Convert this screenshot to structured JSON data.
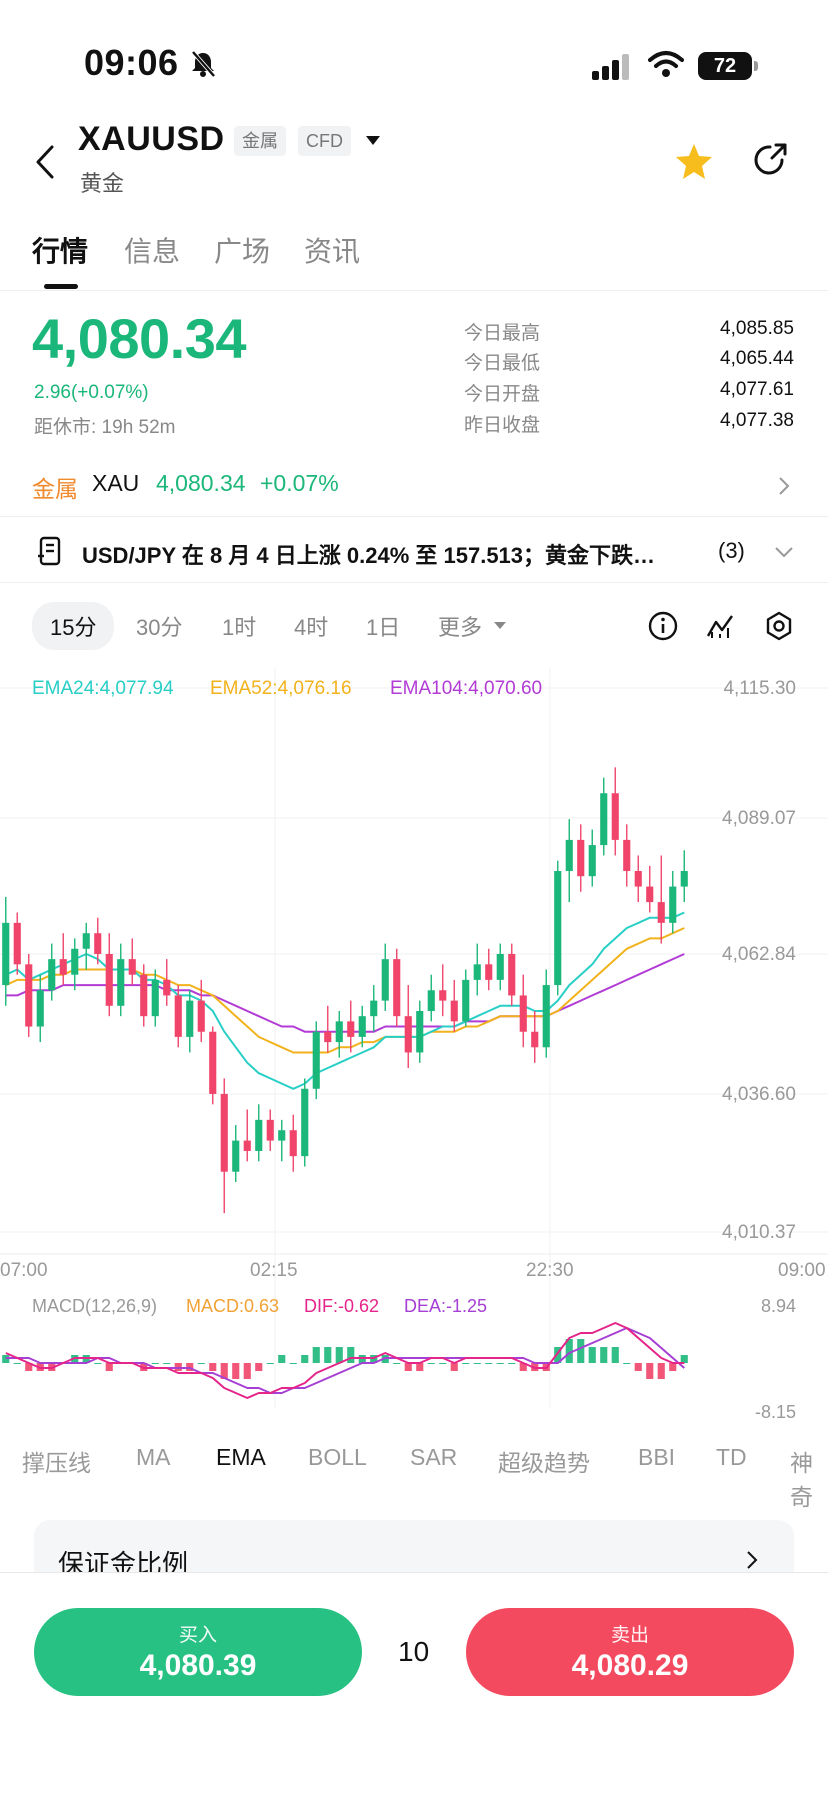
{
  "status_bar": {
    "time": "09:06",
    "battery": "72"
  },
  "header": {
    "symbol": "XAUUSD",
    "tags": [
      "金属",
      "CFD"
    ],
    "name": "黄金"
  },
  "tabs": [
    {
      "label": "行情"
    },
    {
      "label": "信息"
    },
    {
      "label": "广场"
    },
    {
      "label": "资讯"
    }
  ],
  "quote": {
    "price": "4,080.34",
    "change": "2.96(+0.07%)",
    "countdown": "距休市: 19h 52m",
    "stats": [
      {
        "label": "今日最高",
        "value": "4,085.85"
      },
      {
        "label": "今日最低",
        "value": "4,065.44"
      },
      {
        "label": "今日开盘",
        "value": "4,077.61"
      },
      {
        "label": "昨日收盘",
        "value": "4,077.38"
      }
    ]
  },
  "metal_row": {
    "category": "金属",
    "code": "XAU",
    "price": "4,080.34",
    "change": "+0.07%"
  },
  "news": {
    "headline": "USD/JPY 在 8 月 4 日上涨 0.24% 至 157.513；黄金下跌…",
    "count": "(3)"
  },
  "periods": [
    {
      "label": "15分"
    },
    {
      "label": "30分"
    },
    {
      "label": "1时"
    },
    {
      "label": "4时"
    },
    {
      "label": "1日"
    },
    {
      "label": "更多"
    }
  ],
  "colors": {
    "up": "#1bb77a",
    "down": "#f0446a",
    "ema24": "#27cfc6",
    "ema52": "#f2b21c",
    "ema104": "#b23bd6",
    "macd": "#f2a134",
    "dif": "#e5258a",
    "dea": "#a63fd4"
  },
  "chart_data": {
    "type": "candlestick",
    "legend": [
      {
        "name": "EMA24",
        "value": "EMA24:4,077.94"
      },
      {
        "name": "EMA52",
        "value": "EMA52:4,076.16"
      },
      {
        "name": "EMA104",
        "value": "EMA104:4,070.60"
      }
    ],
    "y_ticks": [
      "4,115.30",
      "4,089.07",
      "4,062.84",
      "4,036.60",
      "4,010.37"
    ],
    "ylim": [
      4010.37,
      4115.3
    ],
    "x_ticks": [
      "07:00",
      "02:15",
      "22:30",
      "09:00"
    ],
    "ohlc": [
      [
        4058,
        4075,
        4054,
        4070
      ],
      [
        4070,
        4072,
        4060,
        4062
      ],
      [
        4062,
        4064,
        4048,
        4050
      ],
      [
        4050,
        4060,
        4047,
        4057
      ],
      [
        4057,
        4066,
        4055,
        4063
      ],
      [
        4063,
        4068,
        4058,
        4060
      ],
      [
        4060,
        4067,
        4057,
        4065
      ],
      [
        4065,
        4070,
        4061,
        4068
      ],
      [
        4068,
        4071,
        4062,
        4064
      ],
      [
        4064,
        4068,
        4052,
        4054
      ],
      [
        4054,
        4066,
        4052,
        4063
      ],
      [
        4063,
        4067,
        4058,
        4060
      ],
      [
        4060,
        4062,
        4050,
        4052
      ],
      [
        4052,
        4061,
        4050,
        4059
      ],
      [
        4059,
        4063,
        4054,
        4056
      ],
      [
        4056,
        4058,
        4046,
        4048
      ],
      [
        4048,
        4057,
        4045,
        4055
      ],
      [
        4055,
        4059,
        4047,
        4049
      ],
      [
        4049,
        4050,
        4035,
        4037
      ],
      [
        4037,
        4040,
        4014,
        4022
      ],
      [
        4022,
        4031,
        4020,
        4028
      ],
      [
        4028,
        4034,
        4024,
        4026
      ],
      [
        4026,
        4035,
        4024,
        4032
      ],
      [
        4032,
        4034,
        4026,
        4028
      ],
      [
        4028,
        4032,
        4024,
        4030
      ],
      [
        4030,
        4033,
        4022,
        4025
      ],
      [
        4025,
        4040,
        4023,
        4038
      ],
      [
        4038,
        4051,
        4036,
        4049
      ],
      [
        4049,
        4054,
        4045,
        4047
      ],
      [
        4047,
        4053,
        4044,
        4051
      ],
      [
        4051,
        4055,
        4045,
        4048
      ],
      [
        4048,
        4054,
        4046,
        4052
      ],
      [
        4052,
        4058,
        4049,
        4055
      ],
      [
        4055,
        4066,
        4053,
        4063
      ],
      [
        4063,
        4065,
        4050,
        4052
      ],
      [
        4052,
        4058,
        4042,
        4045
      ],
      [
        4045,
        4055,
        4043,
        4053
      ],
      [
        4053,
        4060,
        4051,
        4057
      ],
      [
        4057,
        4062,
        4052,
        4055
      ],
      [
        4055,
        4059,
        4049,
        4051
      ],
      [
        4051,
        4061,
        4050,
        4059
      ],
      [
        4059,
        4066,
        4056,
        4062
      ],
      [
        4062,
        4065,
        4057,
        4059
      ],
      [
        4059,
        4066,
        4057,
        4064
      ],
      [
        4064,
        4066,
        4054,
        4056
      ],
      [
        4056,
        4060,
        4046,
        4049
      ],
      [
        4049,
        4053,
        4043,
        4046
      ],
      [
        4046,
        4061,
        4044,
        4058
      ],
      [
        4058,
        4082,
        4056,
        4080
      ],
      [
        4080,
        4090,
        4074,
        4086
      ],
      [
        4086,
        4089,
        4076,
        4079
      ],
      [
        4079,
        4088,
        4077,
        4085
      ],
      [
        4085,
        4098,
        4083,
        4095
      ],
      [
        4095,
        4100,
        4083,
        4086
      ],
      [
        4086,
        4089,
        4077,
        4080
      ],
      [
        4080,
        4083,
        4074,
        4077
      ],
      [
        4077,
        4081,
        4072,
        4074
      ],
      [
        4074,
        4083,
        4066,
        4070
      ],
      [
        4070,
        4080,
        4068,
        4077
      ],
      [
        4077,
        4084,
        4074,
        4080
      ]
    ],
    "ema24": [
      4060,
      4061,
      4059,
      4060,
      4061,
      4062,
      4063,
      4064,
      4063,
      4061,
      4061,
      4061,
      4059,
      4059,
      4058,
      4056,
      4056,
      4055,
      4053,
      4049,
      4046,
      4043,
      4041,
      4040,
      4039,
      4038,
      4039,
      4041,
      4042,
      4043,
      4044,
      4045,
      4046,
      4048,
      4048,
      4048,
      4048,
      4049,
      4050,
      4050,
      4051,
      4052,
      4053,
      4054,
      4054,
      4054,
      4053,
      4053,
      4055,
      4058,
      4060,
      4062,
      4065,
      4067,
      4069,
      4070,
      4071,
      4071,
      4071,
      4072
    ],
    "ema52": [
      4058,
      4059,
      4059,
      4059,
      4060,
      4060,
      4061,
      4061,
      4061,
      4061,
      4061,
      4061,
      4060,
      4060,
      4059,
      4058,
      4058,
      4057,
      4056,
      4054,
      4052,
      4050,
      4048,
      4047,
      4046,
      4045,
      4045,
      4045,
      4045,
      4046,
      4046,
      4047,
      4047,
      4048,
      4048,
      4048,
      4048,
      4049,
      4049,
      4049,
      4050,
      4050,
      4051,
      4052,
      4052,
      4052,
      4052,
      4052,
      4053,
      4055,
      4057,
      4059,
      4061,
      4063,
      4065,
      4066,
      4067,
      4067,
      4068,
      4069
    ],
    "ema104": [
      4056,
      4056,
      4057,
      4057,
      4057,
      4058,
      4058,
      4058,
      4058,
      4058,
      4058,
      4058,
      4058,
      4058,
      4057,
      4057,
      4057,
      4056,
      4056,
      4055,
      4054,
      4053,
      4052,
      4051,
      4050,
      4050,
      4049,
      4049,
      4049,
      4049,
      4049,
      4049,
      4049,
      4050,
      4050,
      4050,
      4050,
      4050,
      4050,
      4050,
      4051,
      4051,
      4051,
      4052,
      4052,
      4052,
      4052,
      4052,
      4053,
      4054,
      4055,
      4056,
      4057,
      4058,
      4059,
      4060,
      4061,
      4062,
      4063,
      4064
    ]
  },
  "macd": {
    "params": "MACD(12,26,9)",
    "macd": "MACD:0.63",
    "dif": "DIF:-0.62",
    "dea": "DEA:-1.25",
    "y_max": "8.94",
    "y_min": "-8.15",
    "dif_series": [
      2,
      1,
      0,
      -1,
      -1,
      0,
      1,
      1,
      1,
      0,
      0,
      0,
      -1,
      -1,
      -1,
      -2,
      -2,
      -2,
      -3,
      -5,
      -6,
      -7,
      -6,
      -6,
      -5,
      -5,
      -4,
      -2,
      -1,
      0,
      1,
      1,
      1,
      2,
      1,
      0,
      0,
      1,
      1,
      0,
      1,
      1,
      1,
      1,
      1,
      0,
      -1,
      -1,
      2,
      5,
      6,
      6,
      7,
      8,
      7,
      5,
      3,
      1,
      0,
      0
    ],
    "dea_series": [
      1,
      1,
      1,
      0,
      0,
      0,
      0,
      0,
      1,
      1,
      0,
      0,
      0,
      -1,
      -1,
      -1,
      -1,
      -2,
      -2,
      -3,
      -4,
      -5,
      -5,
      -6,
      -6,
      -5,
      -5,
      -4,
      -3,
      -2,
      -1,
      0,
      0,
      1,
      1,
      1,
      1,
      1,
      1,
      1,
      1,
      1,
      1,
      1,
      1,
      1,
      0,
      0,
      0,
      2,
      3,
      4,
      5,
      6,
      7,
      6,
      5,
      3,
      1,
      -1
    ]
  },
  "indicators": [
    "撑压线",
    "MA",
    "EMA",
    "BOLL",
    "SAR",
    "超级趋势",
    "BBI",
    "TD",
    "神奇"
  ],
  "margin_label": "保证金比例",
  "trade": {
    "buy_label": "买入",
    "buy_price": "4,080.39",
    "qty": "10",
    "sell_label": "卖出",
    "sell_price": "4,080.29"
  }
}
